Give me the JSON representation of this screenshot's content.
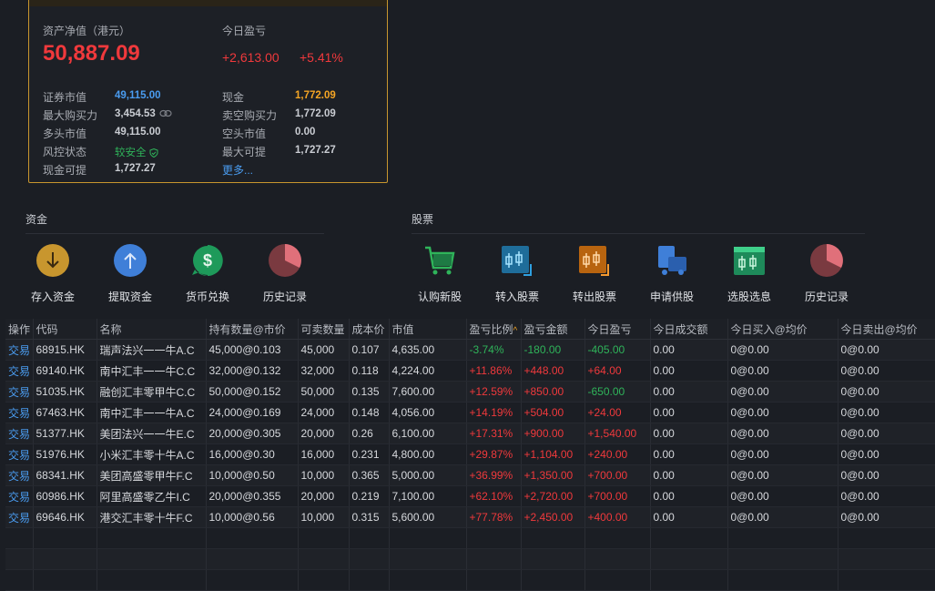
{
  "account": {
    "net_value_label": "资产净值（港元）",
    "net_value": "50,887.09",
    "today_pnl_label": "今日盈亏",
    "today_pnl": "+2,613.00",
    "today_pnl_pct": "+5.41%",
    "left": [
      {
        "label": "证券市值",
        "value": "49,115.00"
      },
      {
        "label": "最大购买力",
        "value": "3,454.53"
      },
      {
        "label": "多头市值",
        "value": "49,115.00"
      },
      {
        "label": "风控状态",
        "value": "较安全"
      },
      {
        "label": "现金可提",
        "value": "1,727.27"
      }
    ],
    "right": [
      {
        "label": "现金",
        "value": "1,772.09"
      },
      {
        "label": "卖空购买力",
        "value": "1,772.09"
      },
      {
        "label": "空头市值",
        "value": "0.00"
      },
      {
        "label": "最大可提",
        "value": "1,727.27"
      }
    ],
    "more_link": "更多..."
  },
  "funds": {
    "title": "资金",
    "actions": [
      {
        "label": "存入资金",
        "icon": "deposit-icon"
      },
      {
        "label": "提取资金",
        "icon": "withdraw-icon"
      },
      {
        "label": "货币兑换",
        "icon": "currency-exchange-icon"
      },
      {
        "label": "历史记录",
        "icon": "history-icon"
      }
    ]
  },
  "stocks": {
    "title": "股票",
    "actions": [
      {
        "label": "认购新股",
        "icon": "ipo-cart-icon"
      },
      {
        "label": "转入股票",
        "icon": "transfer-in-icon"
      },
      {
        "label": "转出股票",
        "icon": "transfer-out-icon"
      },
      {
        "label": "申请供股",
        "icon": "rights-issue-icon"
      },
      {
        "label": "选股选息",
        "icon": "stock-selection-icon"
      },
      {
        "label": "历史记录",
        "icon": "history-icon"
      }
    ]
  },
  "table": {
    "columns": [
      "操作",
      "代码",
      "名称",
      "持有数量@市价",
      "可卖数量",
      "成本价",
      "市值",
      "盈亏比例",
      "盈亏金额",
      "今日盈亏",
      "今日成交额",
      "今日买入@均价",
      "今日卖出@均价"
    ],
    "rows": [
      [
        "交易",
        "68915.HK",
        "瑞声法兴一一牛A.C",
        "45,000@0.103",
        "45,000",
        "0.107",
        "4,635.00",
        "-3.74%",
        "-180.00",
        "-405.00",
        "0.00",
        "0@0.00",
        "0@0.00"
      ],
      [
        "交易",
        "69140.HK",
        "南中汇丰一一牛C.C",
        "32,000@0.132",
        "32,000",
        "0.118",
        "4,224.00",
        "+11.86%",
        "+448.00",
        "+64.00",
        "0.00",
        "0@0.00",
        "0@0.00"
      ],
      [
        "交易",
        "51035.HK",
        "融创汇丰零甲牛C.C",
        "50,000@0.152",
        "50,000",
        "0.135",
        "7,600.00",
        "+12.59%",
        "+850.00",
        "-650.00",
        "0.00",
        "0@0.00",
        "0@0.00"
      ],
      [
        "交易",
        "67463.HK",
        "南中汇丰一一牛A.C",
        "24,000@0.169",
        "24,000",
        "0.148",
        "4,056.00",
        "+14.19%",
        "+504.00",
        "+24.00",
        "0.00",
        "0@0.00",
        "0@0.00"
      ],
      [
        "交易",
        "51377.HK",
        "美团法兴一一牛E.C",
        "20,000@0.305",
        "20,000",
        "0.26",
        "6,100.00",
        "+17.31%",
        "+900.00",
        "+1,540.00",
        "0.00",
        "0@0.00",
        "0@0.00"
      ],
      [
        "交易",
        "51976.HK",
        "小米汇丰零十牛A.C",
        "16,000@0.30",
        "16,000",
        "0.231",
        "4,800.00",
        "+29.87%",
        "+1,104.00",
        "+240.00",
        "0.00",
        "0@0.00",
        "0@0.00"
      ],
      [
        "交易",
        "68341.HK",
        "美团高盛零甲牛F.C",
        "10,000@0.50",
        "10,000",
        "0.365",
        "5,000.00",
        "+36.99%",
        "+1,350.00",
        "+700.00",
        "0.00",
        "0@0.00",
        "0@0.00"
      ],
      [
        "交易",
        "60986.HK",
        "阿里高盛零乙牛I.C",
        "20,000@0.355",
        "20,000",
        "0.219",
        "7,100.00",
        "+62.10%",
        "+2,720.00",
        "+700.00",
        "0.00",
        "0@0.00",
        "0@0.00"
      ],
      [
        "交易",
        "69646.HK",
        "港交汇丰零十牛F.C",
        "10,000@0.56",
        "10,000",
        "0.315",
        "5,600.00",
        "+77.78%",
        "+2,450.00",
        "+400.00",
        "0.00",
        "0@0.00",
        "0@0.00"
      ]
    ]
  },
  "colors": {
    "accent_border": "#c8962e",
    "up": "#f0393c",
    "down": "#2fb45a",
    "link": "#4a9cf0",
    "warn": "#f5a524"
  }
}
